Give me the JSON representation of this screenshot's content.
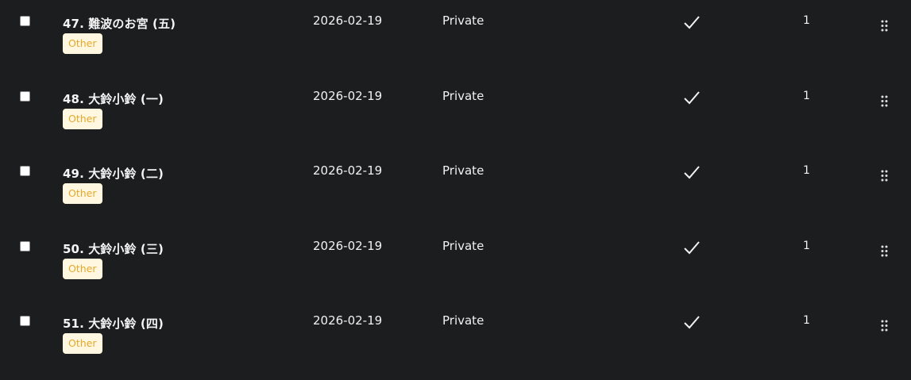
{
  "rows": [
    {
      "title": "47. 難波のお宮 (五)",
      "tag": "Other",
      "date": "2026-02-19",
      "visibility": "Private",
      "count": "1"
    },
    {
      "title": "48. 大鈴小鈴 (一)",
      "tag": "Other",
      "date": "2026-02-19",
      "visibility": "Private",
      "count": "1"
    },
    {
      "title": "49. 大鈴小鈴 (二)",
      "tag": "Other",
      "date": "2026-02-19",
      "visibility": "Private",
      "count": "1"
    },
    {
      "title": "50. 大鈴小鈴 (三)",
      "tag": "Other",
      "date": "2026-02-19",
      "visibility": "Private",
      "count": "1"
    },
    {
      "title": "51. 大鈴小鈴 (四)",
      "tag": "Other",
      "date": "2026-02-19",
      "visibility": "Private",
      "count": "1"
    }
  ],
  "icons": {
    "status": "checkmark-icon",
    "handle": "drag-handle-icon"
  },
  "colors": {
    "background": "#1c1d1f",
    "tag_background": "#fff7e0",
    "tag_text": "#e6a82a",
    "text": "#f2f2f2"
  }
}
